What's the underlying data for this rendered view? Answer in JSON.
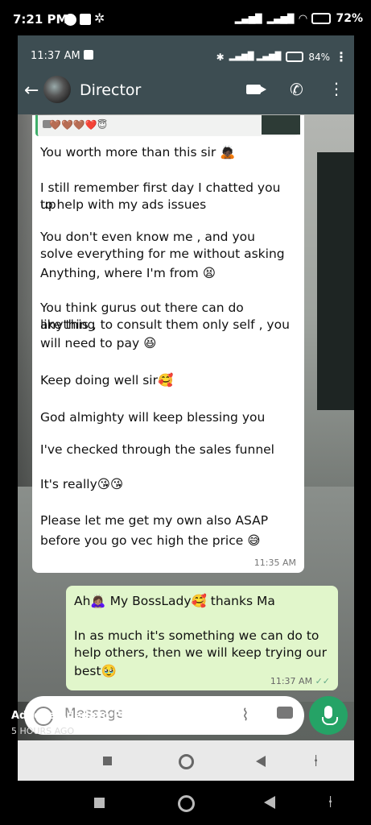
{
  "outer_status": {
    "time": "7:21 PM",
    "battery": "72%",
    "icons": [
      "facebook-icon",
      "v-app-icon",
      "settings-icon",
      "signal-icon",
      "wifi-icon",
      "battery-icon"
    ]
  },
  "inner_status": {
    "time": "11:37 AM",
    "battery": "84%"
  },
  "chat": {
    "contact_name": "Director"
  },
  "incoming": {
    "quote_preview": "🤎🤎🤎❤️😇",
    "lines": [
      "You worth more than this sir 🙇🏿",
      "I still remember first day I chatted you up",
      "to help with my ads issues",
      "You don't even know me , and you",
      "solve everything for me without asking",
      "Anything, where I'm from 😫",
      "You think gurus out there can do anything",
      "like this , to consult them only self , you",
      "will need to pay 😆",
      "Keep doing well sir🥰",
      "God almighty will keep blessing you",
      "I've checked through the sales funnel",
      "It's really😘😘",
      "Please let me get my own also ASAP",
      "before you go vec high the price 😅"
    ],
    "time": "11:35 AM"
  },
  "outgoing": {
    "lines": [
      "Ah🙇🏽‍♀️ My BossLady🥰 thanks Ma",
      "In as much it's something we can do to",
      "help others, then we will keep trying our",
      "best🥹"
    ],
    "time": "11:37 AM"
  },
  "input": {
    "placeholder": "Message"
  },
  "story": {
    "name": "Adeoye Adedayo Philip",
    "time": "5 HOURS AGO"
  }
}
